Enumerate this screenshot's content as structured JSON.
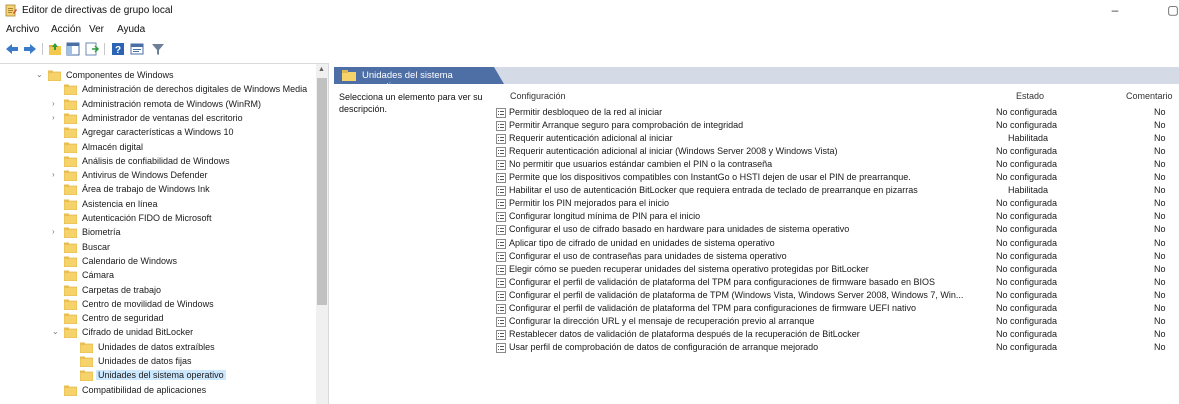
{
  "window": {
    "title": "Editor de directivas de grupo local"
  },
  "menu": [
    "Archivo",
    "Acción",
    "Ver",
    "Ayuda"
  ],
  "toolbar_icons": [
    "back-icon",
    "forward-icon",
    "up-folder-icon",
    "show-tree-icon",
    "export-icon",
    "help-icon",
    "properties-icon",
    "filter-icon"
  ],
  "tree": [
    {
      "label": "Componentes de Windows",
      "depth": 0,
      "arrow": "expanded"
    },
    {
      "label": "Administración de derechos digitales de Windows Media",
      "depth": 1,
      "arrow": "none"
    },
    {
      "label": "Administración remota de Windows (WinRM)",
      "depth": 1,
      "arrow": "collapsed"
    },
    {
      "label": "Administrador de ventanas del escritorio",
      "depth": 1,
      "arrow": "collapsed"
    },
    {
      "label": "Agregar características a Windows 10",
      "depth": 1,
      "arrow": "none"
    },
    {
      "label": "Almacén digital",
      "depth": 1,
      "arrow": "none"
    },
    {
      "label": "Análisis de confiabilidad de Windows",
      "depth": 1,
      "arrow": "none"
    },
    {
      "label": "Antivirus de Windows Defender",
      "depth": 1,
      "arrow": "collapsed"
    },
    {
      "label": "Área de trabajo de Windows Ink",
      "depth": 1,
      "arrow": "none"
    },
    {
      "label": "Asistencia en línea",
      "depth": 1,
      "arrow": "none"
    },
    {
      "label": "Autenticación FIDO de Microsoft",
      "depth": 1,
      "arrow": "none"
    },
    {
      "label": "Biometría",
      "depth": 1,
      "arrow": "collapsed"
    },
    {
      "label": "Buscar",
      "depth": 1,
      "arrow": "none"
    },
    {
      "label": "Calendario de Windows",
      "depth": 1,
      "arrow": "none"
    },
    {
      "label": "Cámara",
      "depth": 1,
      "arrow": "none"
    },
    {
      "label": "Carpetas de trabajo",
      "depth": 1,
      "arrow": "none"
    },
    {
      "label": "Centro de movilidad de Windows",
      "depth": 1,
      "arrow": "none"
    },
    {
      "label": "Centro de seguridad",
      "depth": 1,
      "arrow": "none"
    },
    {
      "label": "Cifrado de unidad BitLocker",
      "depth": 1,
      "arrow": "expanded"
    },
    {
      "label": "Unidades de datos extraíbles",
      "depth": 2,
      "arrow": "none"
    },
    {
      "label": "Unidades de datos fijas",
      "depth": 2,
      "arrow": "none"
    },
    {
      "label": "Unidades del sistema operativo",
      "depth": 2,
      "arrow": "none",
      "selected": true
    },
    {
      "label": "Compatibilidad de aplicaciones",
      "depth": 1,
      "arrow": "none"
    }
  ],
  "right_pane": {
    "header": "Unidades del sistema operativo",
    "description": "Selecciona un elemento para ver su descripción.",
    "columns": {
      "setting": "Configuración",
      "state": "Estado",
      "comment": "Comentario"
    },
    "rows": [
      {
        "name": "Permitir desbloqueo de la red al iniciar",
        "state": "No configurada",
        "comment": "No"
      },
      {
        "name": "Permitir Arranque seguro para comprobación de integridad",
        "state": "No configurada",
        "comment": "No"
      },
      {
        "name": "Requerir autenticación adicional al iniciar",
        "state": "Habilitada",
        "comment": "No"
      },
      {
        "name": "Requerir autenticación adicional al iniciar (Windows Server 2008 y Windows Vista)",
        "state": "No configurada",
        "comment": "No"
      },
      {
        "name": "No permitir que usuarios estándar cambien el PIN o la contraseña",
        "state": "No configurada",
        "comment": "No"
      },
      {
        "name": "Permite que los dispositivos compatibles con InstantGo o HSTI dejen de usar el PIN de prearranque.",
        "state": "No configurada",
        "comment": "No"
      },
      {
        "name": "Habilitar el uso de autenticación BitLocker que requiera entrada de teclado de prearranque en pizarras",
        "state": "Habilitada",
        "comment": "No"
      },
      {
        "name": "Permitir los PIN mejorados para el inicio",
        "state": "No configurada",
        "comment": "No"
      },
      {
        "name": "Configurar longitud mínima de PIN para el inicio",
        "state": "No configurada",
        "comment": "No"
      },
      {
        "name": "Configurar el uso de cifrado basado en hardware para unidades de sistema operativo",
        "state": "No configurada",
        "comment": "No"
      },
      {
        "name": "Aplicar tipo de cifrado de unidad en unidades de sistema operativo",
        "state": "No configurada",
        "comment": "No"
      },
      {
        "name": "Configurar el uso de contraseñas para unidades de sistema operativo",
        "state": "No configurada",
        "comment": "No"
      },
      {
        "name": "Elegir cómo se pueden recuperar unidades del sistema operativo protegidas por BitLocker",
        "state": "No configurada",
        "comment": "No"
      },
      {
        "name": "Configurar el perfil de validación de plataforma del TPM para configuraciones de firmware basado en BIOS",
        "state": "No configurada",
        "comment": "No"
      },
      {
        "name": "Configurar el perfil de validación de plataforma de TPM (Windows Vista, Windows Server 2008, Windows 7, Win...",
        "state": "No configurada",
        "comment": "No"
      },
      {
        "name": "Configurar el perfil de validación de plataforma del TPM para configuraciones de firmware UEFI nativo",
        "state": "No configurada",
        "comment": "No"
      },
      {
        "name": "Configurar la dirección URL y el mensaje de recuperación previo al arranque",
        "state": "No configurada",
        "comment": "No"
      },
      {
        "name": "Restablecer datos de validación de plataforma después de la recuperación de BitLocker",
        "state": "No configurada",
        "comment": "No"
      },
      {
        "name": "Usar perfil de comprobación de datos de configuración de arranque mejorado",
        "state": "No configurada",
        "comment": "No"
      }
    ]
  }
}
